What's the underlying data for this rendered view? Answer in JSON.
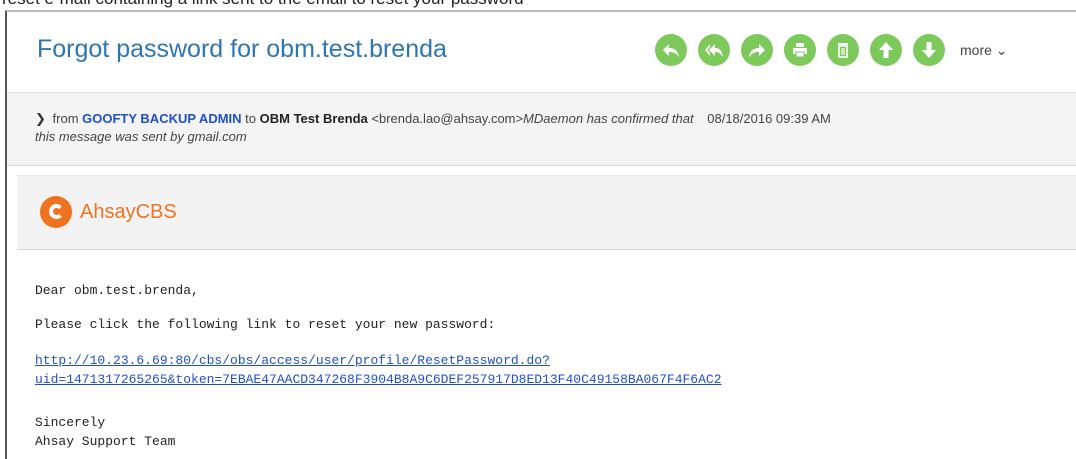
{
  "caption": "reset e-mail containing a link sent to the email to reset your password",
  "subject": "Forgot password for obm.test.brenda",
  "toolbar": {
    "buttons": [
      {
        "icon": "reply-icon"
      },
      {
        "icon": "reply-all-icon"
      },
      {
        "icon": "forward-icon"
      },
      {
        "icon": "print-icon"
      },
      {
        "icon": "delete-icon"
      },
      {
        "icon": "previous-arrow-icon"
      },
      {
        "icon": "next-arrow-icon"
      }
    ],
    "more_label": "more ⌄",
    "button_color": "#7ec95b"
  },
  "header": {
    "arrow": "❯",
    "from_prefix": "from",
    "from_name": "GOOFTY BACKUP ADMIN",
    "to_prefix": "to",
    "to_name": "OBM Test Brenda",
    "to_email": "<brenda.lao@ahsay.com>",
    "mdaemon_text": "MDaemon has confirmed that",
    "date": "08/18/2016 09:39 AM",
    "confirm_text": "this message was sent by gmail.com"
  },
  "brand": {
    "name": "AhsayCBS",
    "color": "#f07321"
  },
  "body": {
    "greeting": "Dear obm.test.brenda,",
    "instruction": "Please click the following link to reset your new password:",
    "link_line1": "http://10.23.6.69:80/cbs/obs/access/user/profile/ResetPassword.do?",
    "link_line2": "uid=1471317265265&token=7EBAE47AACD347268F3904B8A9C6DEF257917D8ED13F40C49158BA067F4F6AC2",
    "sign1": "Sincerely",
    "sign2": "Ahsay Support Team"
  }
}
